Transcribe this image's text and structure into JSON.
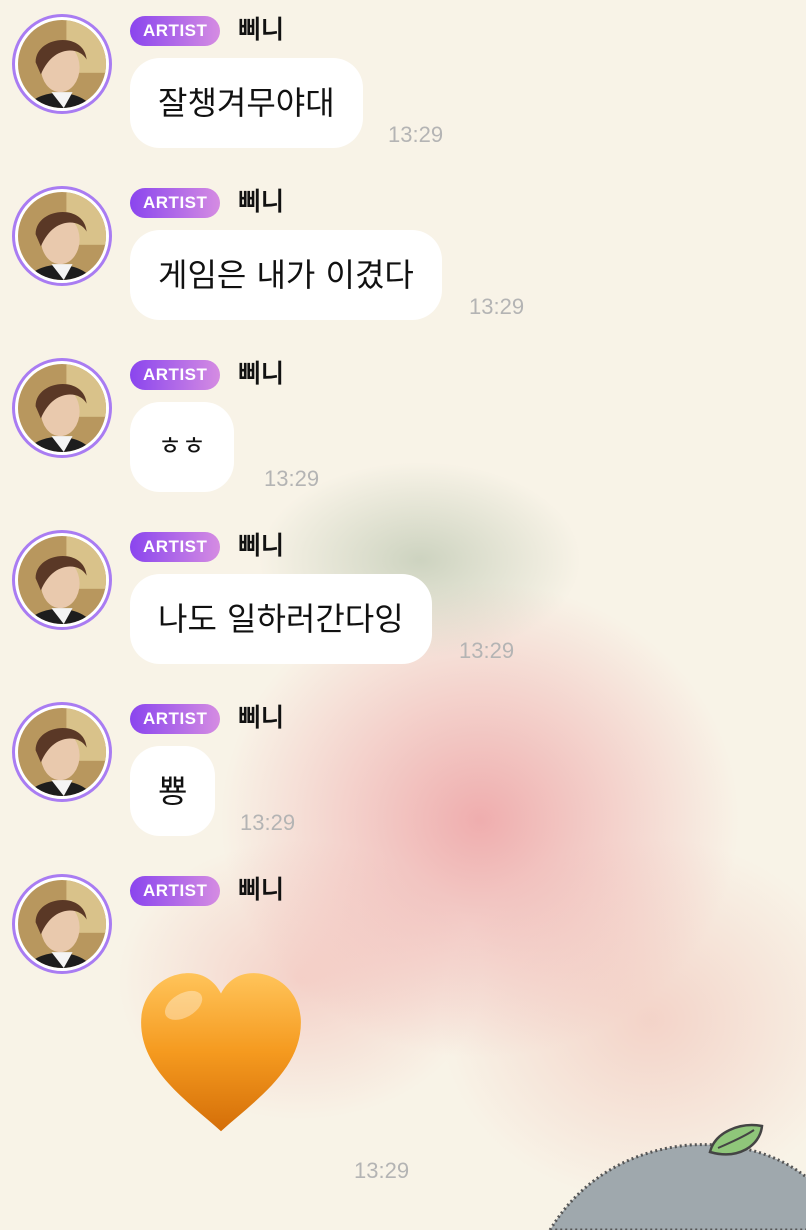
{
  "chat": {
    "messages": [
      {
        "badge": "ARTIST",
        "sender": "삐니",
        "text": "잘챙겨무야대",
        "time": "13:29"
      },
      {
        "badge": "ARTIST",
        "sender": "삐니",
        "text": "게임은 내가 이겼다",
        "time": "13:29"
      },
      {
        "badge": "ARTIST",
        "sender": "삐니",
        "text": "ㅎㅎ",
        "time": "13:29"
      },
      {
        "badge": "ARTIST",
        "sender": "삐니",
        "text": "나도 일하러간다잉",
        "time": "13:29"
      },
      {
        "badge": "ARTIST",
        "sender": "삐니",
        "text": "뿅",
        "time": "13:29"
      },
      {
        "badge": "ARTIST",
        "sender": "삐니",
        "emoji": "orange-heart-icon",
        "time": "13:29"
      }
    ]
  },
  "colors": {
    "background": "#f8f3e7",
    "badge_start": "#8a45ee",
    "badge_end": "#d58ce2",
    "avatar_ring": "#a97cf2",
    "bubble": "#ffffff",
    "time_text": "#b4b4b4",
    "heart": "#f39a1c"
  }
}
